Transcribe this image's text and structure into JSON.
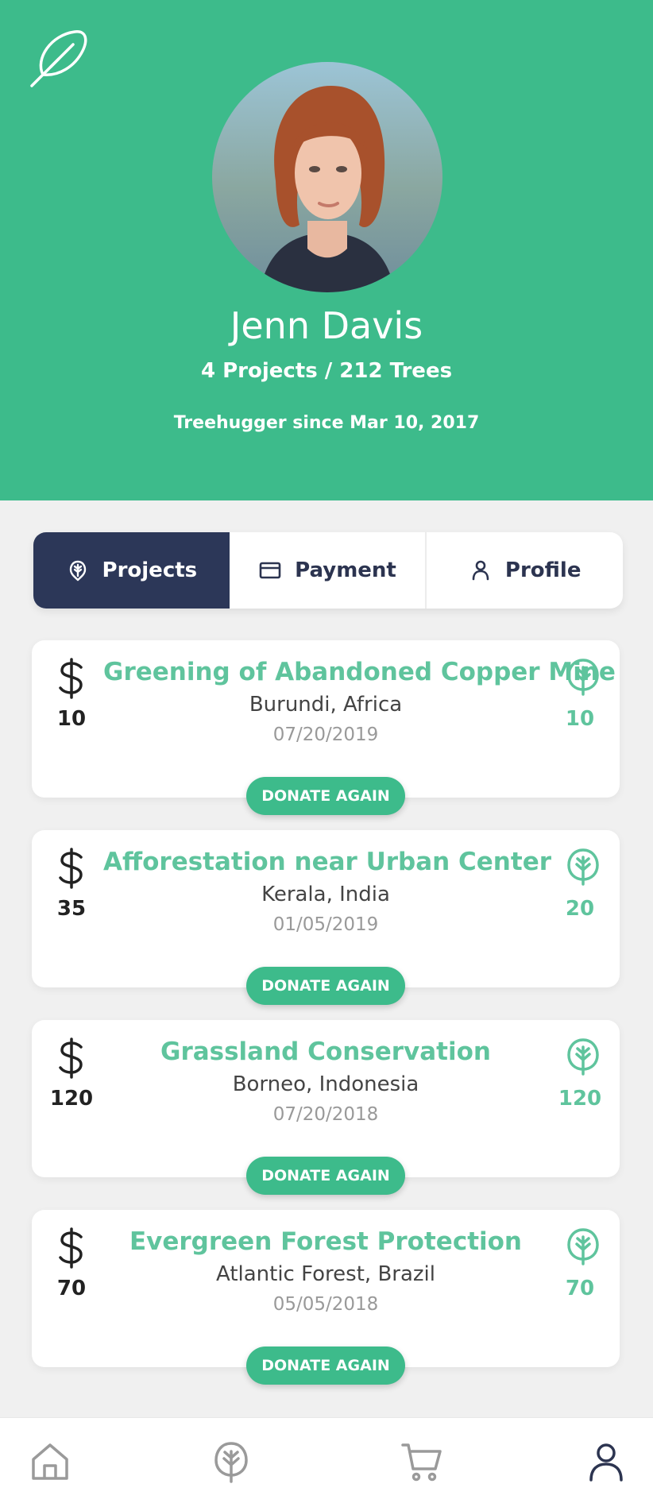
{
  "header": {
    "name": "Jenn Davis",
    "stats": "4 Projects / 212 Trees",
    "since": "Treehugger since Mar 10, 2017",
    "logo_icon": "feather-icon",
    "background_color": "#3dbb8b"
  },
  "tabs": [
    {
      "label": "Projects",
      "icon": "leaf-pin-icon",
      "active": true
    },
    {
      "label": "Payment",
      "icon": "credit-card-icon",
      "active": false
    },
    {
      "label": "Profile",
      "icon": "user-icon",
      "active": false
    }
  ],
  "projects": [
    {
      "amount": "10",
      "title": "Greening of Abandoned Copper Mine",
      "location": "Burundi, Africa",
      "date": "07/20/2019",
      "trees": "10",
      "button": "DONATE AGAIN"
    },
    {
      "amount": "35",
      "title": "Afforestation near Urban Center",
      "location": "Kerala, India",
      "date": "01/05/2019",
      "trees": "20",
      "button": "DONATE AGAIN"
    },
    {
      "amount": "120",
      "title": "Grassland Conservation",
      "location": "Borneo, Indonesia",
      "date": "07/20/2018",
      "trees": "120",
      "button": "DONATE AGAIN"
    },
    {
      "amount": "70",
      "title": "Evergreen Forest Protection",
      "location": "Atlantic Forest, Brazil",
      "date": "05/05/2018",
      "trees": "70",
      "button": "DONATE AGAIN"
    }
  ],
  "bottom_nav": [
    {
      "icon": "home-icon"
    },
    {
      "icon": "leaf-icon"
    },
    {
      "icon": "cart-icon"
    },
    {
      "icon": "user-icon"
    }
  ],
  "colors": {
    "accent": "#3dbb8b",
    "accent_text": "#5fc49d",
    "active_tab": "#2c3758"
  }
}
